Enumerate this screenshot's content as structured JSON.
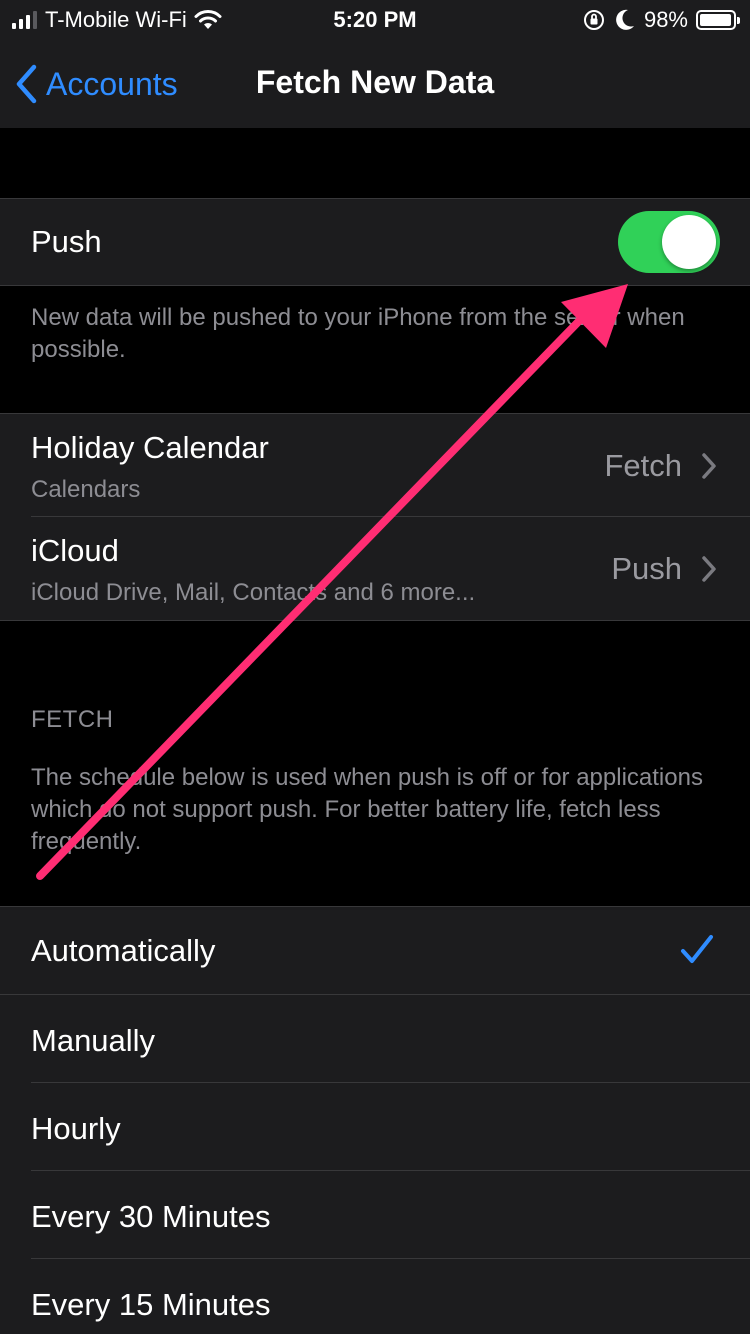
{
  "status_bar": {
    "carrier": "T-Mobile Wi-Fi",
    "time": "5:20 PM",
    "battery": "98%",
    "battery_level": 0.98
  },
  "nav": {
    "back_label": "Accounts",
    "title": "Fetch New Data"
  },
  "push": {
    "label": "Push",
    "enabled": true,
    "description": "New data will be pushed to your iPhone from the server when possible."
  },
  "accounts": [
    {
      "title": "Holiday Calendar",
      "subtitle": "Calendars",
      "value": "Fetch"
    },
    {
      "title": "iCloud",
      "subtitle": "iCloud Drive, Mail, Contacts and 6 more...",
      "value": "Push"
    }
  ],
  "fetch": {
    "header": "FETCH",
    "description": "The schedule below is used when push is off or for applications which do not support push. For better battery life, fetch less frequently.",
    "options": [
      {
        "label": "Automatically",
        "selected": true
      },
      {
        "label": "Manually",
        "selected": false
      },
      {
        "label": "Hourly",
        "selected": false
      },
      {
        "label": "Every 30 Minutes",
        "selected": false
      },
      {
        "label": "Every 15 Minutes",
        "selected": false
      }
    ]
  },
  "colors": {
    "accent": "#2f8cff",
    "toggle_on": "#30d158",
    "annotation_arrow": "#ff2d73"
  }
}
